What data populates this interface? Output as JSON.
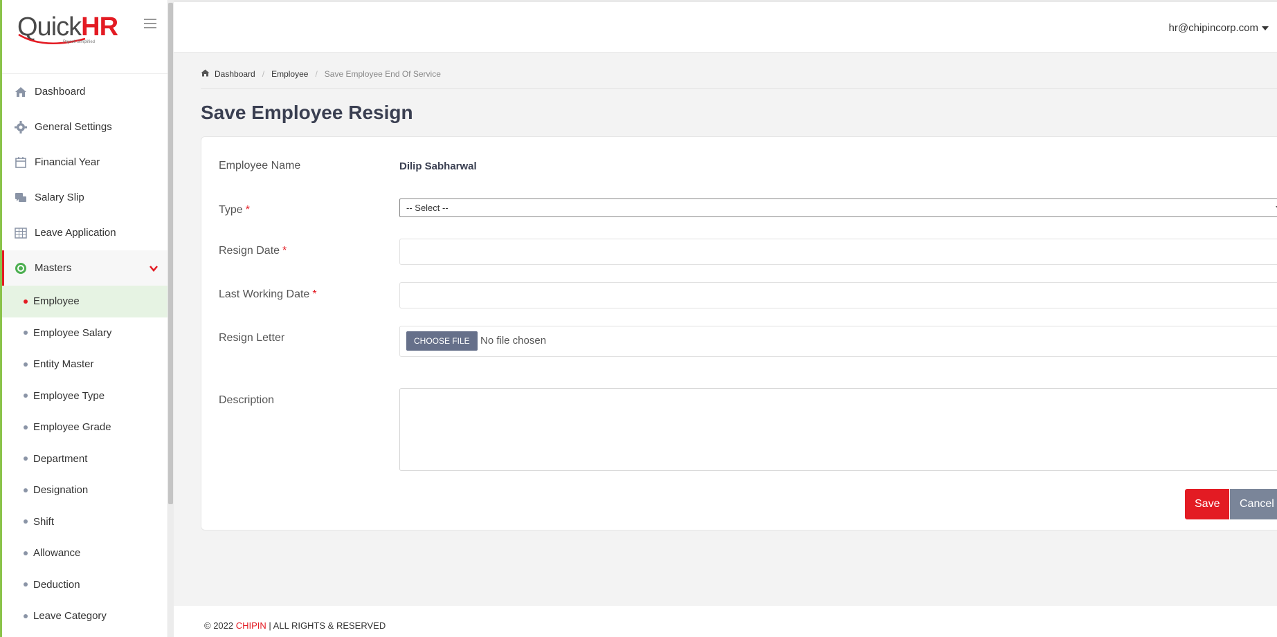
{
  "logo": {
    "text_left": "Quick",
    "text_right": "HR",
    "tagline": "Payroll Simplified"
  },
  "sidebar": {
    "items": [
      {
        "label": "Dashboard",
        "icon": "home-icon"
      },
      {
        "label": "General Settings",
        "icon": "gear-icon"
      },
      {
        "label": "Financial Year",
        "icon": "calendar-icon"
      },
      {
        "label": "Salary Slip",
        "icon": "chat-icon"
      },
      {
        "label": "Leave Application",
        "icon": "table-icon"
      },
      {
        "label": "Masters",
        "icon": "masters-icon"
      }
    ],
    "sub_items": [
      {
        "label": "Employee"
      },
      {
        "label": "Employee Salary"
      },
      {
        "label": "Entity Master"
      },
      {
        "label": "Employee Type"
      },
      {
        "label": "Employee Grade"
      },
      {
        "label": "Department"
      },
      {
        "label": "Designation"
      },
      {
        "label": "Shift"
      },
      {
        "label": "Allowance"
      },
      {
        "label": "Deduction"
      },
      {
        "label": "Leave Category"
      }
    ]
  },
  "header": {
    "user": "hr@chipincorp.com"
  },
  "breadcrumb": {
    "home": "Dashboard",
    "parent": "Employee",
    "current": "Save Employee End Of Service"
  },
  "page": {
    "title": "Save Employee Resign"
  },
  "form": {
    "employee_name_label": "Employee Name",
    "employee_name_value": "Dilip Sabharwal",
    "type_label": "Type",
    "type_value": "-- Select --",
    "resign_date_label": "Resign Date",
    "last_working_label": "Last Working Date",
    "resign_letter_label": "Resign Letter",
    "file_button": "CHOOSE FILE",
    "file_status": "No file chosen",
    "description_label": "Description",
    "required_mark": "*",
    "save": "Save",
    "cancel": "Cancel"
  },
  "footer": {
    "copyright": "© 2022 ",
    "brand": "CHIPIN",
    "rights": " | ALL RIGHTS & RESERVED"
  },
  "colors": {
    "accent": "#e31b23",
    "sidebar_accent": "#8bc34a",
    "active_bg": "#e6f3e3"
  }
}
